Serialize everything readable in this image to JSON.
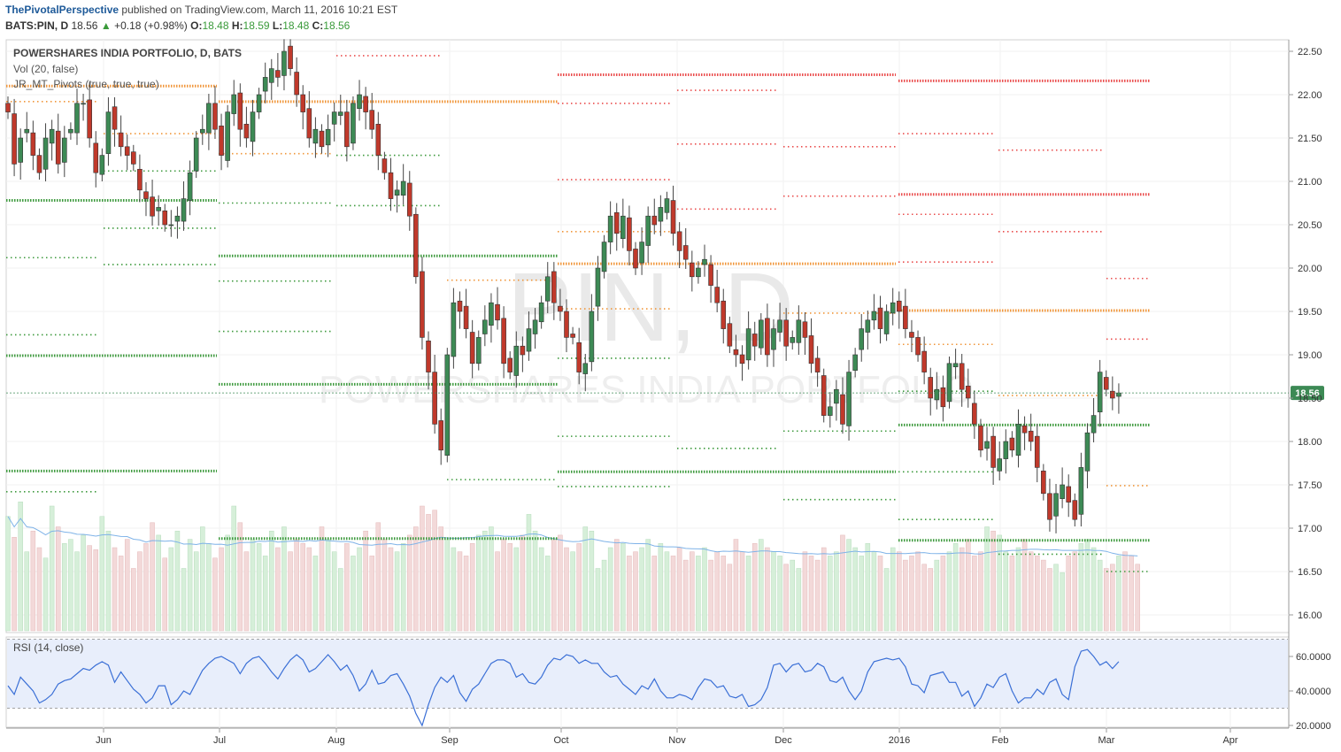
{
  "header": {
    "publisher": "ThePivotalPerspective",
    "published_text": "published on TradingView.com, March 11, 2016 10:21 EST",
    "symbol": "BATS:PIN, D",
    "last": "18.56",
    "change_arrow": "▲",
    "change": "+0.18 (+0.98%)",
    "o_label": "O:",
    "o_value": "18.48",
    "h_label": "H:",
    "h_value": "18.59",
    "l_label": "L:",
    "l_value": "18.48",
    "c_label": "C:",
    "c_value": "18.56"
  },
  "legend": {
    "title": "POWERSHARES INDIA PORTFOLIO, D, BATS",
    "vol": "Vol (20, false)",
    "pivots": "JR_MT_Pivots (true, true, true)"
  },
  "watermark": {
    "symbol": "PIN, D",
    "name": "POWERSHARES INDIA PORTFOLIO"
  },
  "rsi": {
    "label": "RSI (14, close)",
    "ticks": [
      "60.0000",
      "40.0000",
      "20.0000"
    ],
    "upper": 70,
    "lower": 30,
    "values": [
      43,
      38,
      48,
      44,
      40,
      33,
      35,
      38,
      44,
      46,
      47,
      50,
      53,
      52,
      55,
      57,
      55,
      45,
      51,
      46,
      41,
      38,
      33,
      36,
      43,
      43,
      32,
      35,
      40,
      38,
      45,
      52,
      56,
      59,
      60,
      58,
      56,
      50,
      56,
      59,
      60,
      56,
      51,
      47,
      53,
      58,
      61,
      58,
      51,
      53,
      57,
      61,
      57,
      52,
      55,
      49,
      40,
      44,
      52,
      44,
      45,
      49,
      50,
      44,
      37,
      27,
      20,
      32,
      42,
      48,
      45,
      49,
      39,
      34,
      41,
      44,
      50,
      56,
      58,
      58,
      56,
      48,
      50,
      45,
      44,
      48,
      55,
      59,
      58,
      61,
      60,
      56,
      58,
      56,
      56,
      51,
      48,
      49,
      44,
      41,
      38,
      43,
      41,
      47,
      40,
      36,
      36,
      38,
      37,
      35,
      42,
      47,
      46,
      42,
      43,
      37,
      36,
      38,
      31,
      32,
      35,
      42,
      55,
      56,
      51,
      55,
      56,
      51,
      52,
      56,
      54,
      46,
      45,
      48,
      40,
      35,
      40,
      51,
      57,
      58,
      59,
      58,
      59,
      54,
      44,
      43,
      39,
      49,
      50,
      51,
      45,
      45,
      37,
      40,
      31,
      36,
      44,
      42,
      48,
      50,
      40,
      33,
      36,
      36,
      41,
      38,
      45,
      47,
      38,
      35,
      54,
      63,
      64,
      60,
      55,
      57,
      53,
      57
    ]
  },
  "chart_data": {
    "type": "candlestick",
    "title": "POWERSHARES INDIA PORTFOLIO, D, BATS",
    "x_labels": [
      "Jun",
      "Jul",
      "Aug",
      "Sep",
      "Oct",
      "Nov",
      "Dec",
      "2016",
      "Feb",
      "Mar",
      "Apr"
    ],
    "y_ticks": [
      "22.50",
      "22.00",
      "21.50",
      "21.00",
      "20.50",
      "20.00",
      "19.50",
      "19.00",
      "18.50",
      "18.00",
      "17.50",
      "17.00",
      "16.50",
      "16.00"
    ],
    "y_range": [
      15.95,
      22.6
    ],
    "last_price": "18.56",
    "colors": {
      "up": "#3d8a55",
      "down": "#c0392b",
      "pivot": "#3e9a3e",
      "resistance": "#f0963a",
      "resistance2": "#ea4d4d"
    },
    "closes": [
      21.8,
      21.2,
      21.5,
      21.6,
      21.3,
      21.1,
      21.5,
      21.6,
      21.2,
      21.5,
      21.6,
      21.9,
      21.9,
      21.5,
      21.1,
      21.3,
      21.8,
      21.6,
      21.4,
      21.3,
      21.2,
      20.9,
      20.8,
      20.6,
      20.7,
      20.5,
      20.5,
      20.6,
      20.8,
      21.1,
      21.5,
      21.6,
      21.9,
      21.6,
      21.3,
      21.8,
      22.0,
      21.6,
      21.5,
      21.8,
      22.0,
      22.2,
      22.3,
      22.2,
      22.5,
      22.3,
      22.0,
      21.8,
      21.5,
      21.6,
      21.4,
      21.6,
      21.8,
      21.8,
      21.4,
      21.9,
      22.0,
      21.8,
      21.6,
      21.3,
      21.1,
      20.8,
      20.9,
      21.0,
      20.6,
      19.9,
      19.2,
      18.8,
      18.2,
      17.9,
      19.0,
      19.6,
      19.5,
      19.3,
      18.9,
      19.2,
      19.4,
      19.6,
      19.4,
      18.9,
      18.8,
      19.1,
      19.0,
      19.3,
      19.4,
      19.6,
      19.9,
      19.6,
      19.5,
      19.2,
      19.2,
      18.8,
      18.9,
      19.5,
      20.0,
      20.3,
      20.6,
      20.4,
      20.6,
      20.2,
      20.0,
      20.3,
      20.6,
      20.5,
      20.7,
      20.8,
      20.4,
      20.2,
      20.1,
      19.9,
      20.0,
      20.1,
      19.8,
      19.6,
      19.3,
      19.1,
      19.0,
      18.9,
      19.3,
      19.1,
      19.4,
      19.0,
      19.3,
      19.4,
      19.1,
      19.2,
      19.4,
      19.2,
      18.9,
      18.8,
      18.3,
      18.4,
      18.6,
      18.2,
      18.8,
      19.0,
      19.3,
      19.4,
      19.5,
      19.3,
      19.5,
      19.6,
      19.5,
      19.3,
      19.2,
      19.0,
      18.8,
      18.5,
      18.6,
      18.4,
      18.9,
      18.9,
      18.6,
      18.5,
      18.2,
      17.9,
      18.0,
      17.7,
      17.8,
      18.0,
      17.9,
      18.2,
      18.1,
      18.0,
      17.7,
      17.4,
      17.1,
      17.4,
      17.5,
      17.3,
      17.1,
      17.7,
      18.1,
      18.3,
      18.8,
      18.6,
      18.5,
      18.56
    ],
    "volumes": [
      55,
      45,
      62,
      38,
      48,
      40,
      35,
      60,
      50,
      42,
      44,
      38,
      46,
      41,
      39,
      55,
      48,
      40,
      36,
      44,
      30,
      38,
      42,
      52,
      46,
      35,
      40,
      48,
      30,
      44,
      38,
      50,
      42,
      35,
      40,
      46,
      60,
      52,
      38,
      44,
      42,
      36,
      48,
      40,
      50,
      38,
      44,
      42,
      40,
      36,
      50,
      44,
      38,
      30,
      42,
      36,
      40,
      48,
      36,
      52,
      44,
      40,
      38,
      42,
      46,
      50,
      60,
      56,
      58,
      50,
      44,
      40,
      38,
      36,
      42,
      46,
      48,
      50,
      38,
      44,
      42,
      40,
      46,
      56,
      48,
      40,
      36,
      44,
      46,
      40,
      38,
      42,
      50,
      48,
      30,
      34,
      40,
      44,
      42,
      36,
      38,
      40,
      44,
      36,
      42,
      38,
      36,
      40,
      34,
      38,
      36,
      40,
      34,
      38,
      36,
      32,
      44,
      38,
      36,
      42,
      44,
      40,
      38,
      36,
      32,
      34,
      30,
      38,
      36,
      34,
      40,
      36,
      38,
      46,
      44,
      40,
      36,
      42,
      38,
      36,
      30,
      40,
      38,
      34,
      36,
      38,
      32,
      30,
      34,
      36,
      38,
      42,
      40,
      44,
      36,
      38,
      50,
      48,
      46,
      38,
      36,
      40,
      44,
      38,
      36,
      34,
      30,
      32,
      28,
      36,
      38,
      42,
      44,
      40,
      34,
      30,
      32,
      36,
      38,
      36,
      32
    ]
  }
}
